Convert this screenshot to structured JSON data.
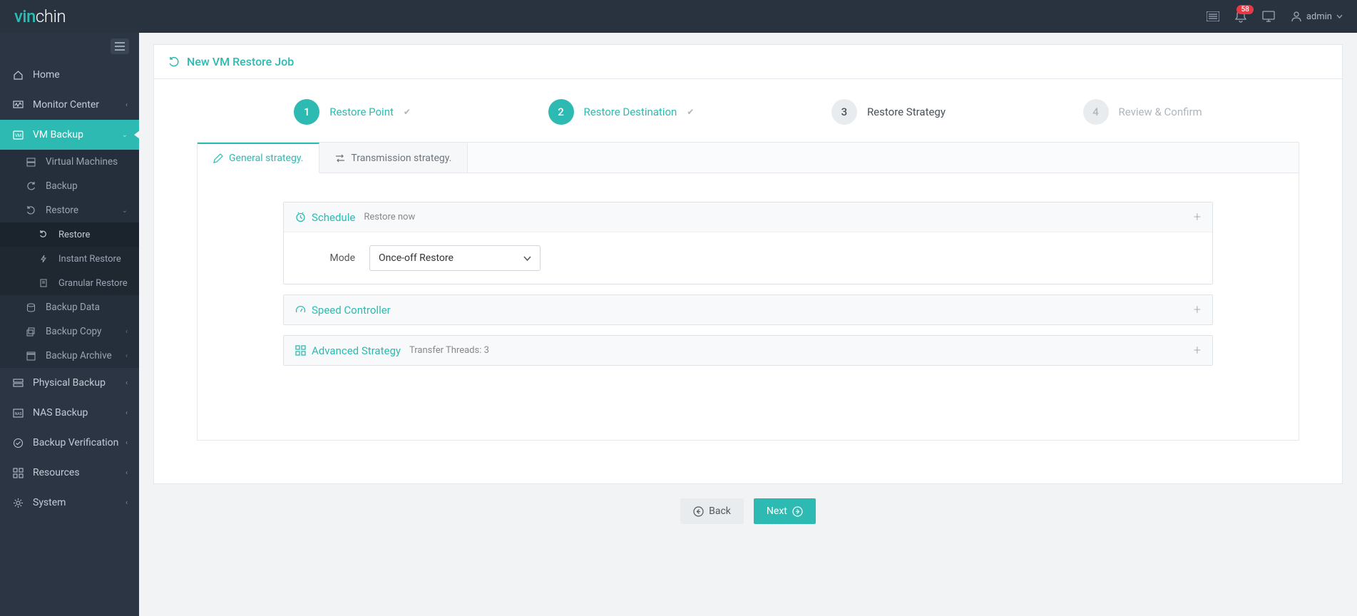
{
  "header": {
    "logo_prefix": "vin",
    "logo_suffix": "chin",
    "notification_count": "58",
    "user_label": "admin"
  },
  "sidebar": {
    "items": [
      {
        "label": "Home"
      },
      {
        "label": "Monitor Center"
      },
      {
        "label": "VM Backup"
      },
      {
        "label": "Physical Backup"
      },
      {
        "label": "NAS Backup"
      },
      {
        "label": "Backup Verification"
      },
      {
        "label": "Resources"
      },
      {
        "label": "System"
      }
    ],
    "vm_backup_sub": [
      {
        "label": "Virtual Machines"
      },
      {
        "label": "Backup"
      },
      {
        "label": "Restore"
      },
      {
        "label": "Backup Data"
      },
      {
        "label": "Backup Copy"
      },
      {
        "label": "Backup Archive"
      }
    ],
    "restore_sub": [
      {
        "label": "Restore"
      },
      {
        "label": "Instant Restore"
      },
      {
        "label": "Granular Restore"
      }
    ]
  },
  "page": {
    "title": "New VM Restore Job",
    "steps": [
      {
        "num": "1",
        "label": "Restore Point"
      },
      {
        "num": "2",
        "label": "Restore Destination"
      },
      {
        "num": "3",
        "label": "Restore Strategy"
      },
      {
        "num": "4",
        "label": "Review & Confirm"
      }
    ],
    "tabs": [
      {
        "label": "General strategy."
      },
      {
        "label": "Transmission strategy."
      }
    ],
    "schedule": {
      "title": "Schedule",
      "subtitle": "Restore now",
      "mode_label": "Mode",
      "mode_value": "Once-off Restore"
    },
    "speed": {
      "title": "Speed Controller"
    },
    "advanced": {
      "title": "Advanced Strategy",
      "subtitle": "Transfer Threads: 3"
    },
    "buttons": {
      "back": "Back",
      "next": "Next"
    }
  }
}
